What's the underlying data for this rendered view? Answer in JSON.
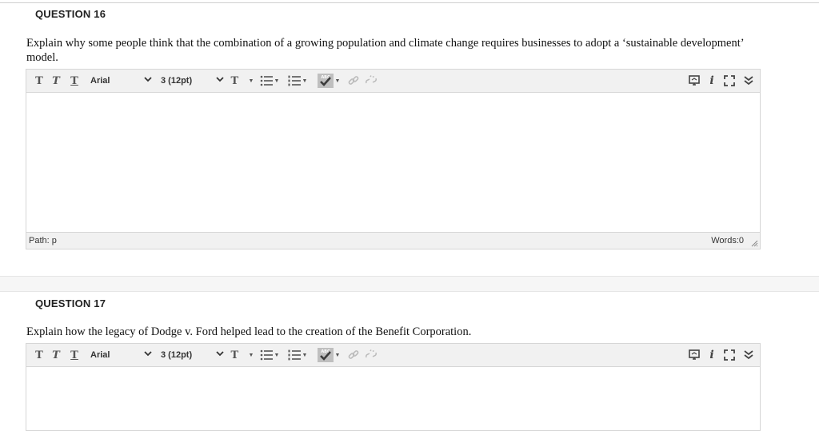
{
  "questions": [
    {
      "title": "QUESTION 16",
      "prompt": "Explain why some people think that the combination of a growing population and climate change requires businesses to adopt a ‘sustainable development’ model.",
      "path_label": "Path: p",
      "words_label": "Words:0"
    },
    {
      "title": "QUESTION 17",
      "prompt": "Explain how the legacy of Dodge v. Ford helped lead to the creation of the Benefit Corporation."
    }
  ],
  "toolbar": {
    "bold_label": "T",
    "italic_label": "T",
    "underline_label": "T",
    "font_family": "Arial",
    "font_size": "3 (12pt)",
    "text_color_label": "T",
    "spell_label": "ABC",
    "info_label": "i",
    "icons": [
      "bold-icon",
      "italic-icon",
      "underline-icon",
      "text-color-icon",
      "unordered-list-icon",
      "ordered-list-icon",
      "spellcheck-icon",
      "link-icon",
      "unlink-icon",
      "preview-icon",
      "info-icon",
      "fullscreen-icon",
      "expand-toolbar-icon"
    ]
  }
}
